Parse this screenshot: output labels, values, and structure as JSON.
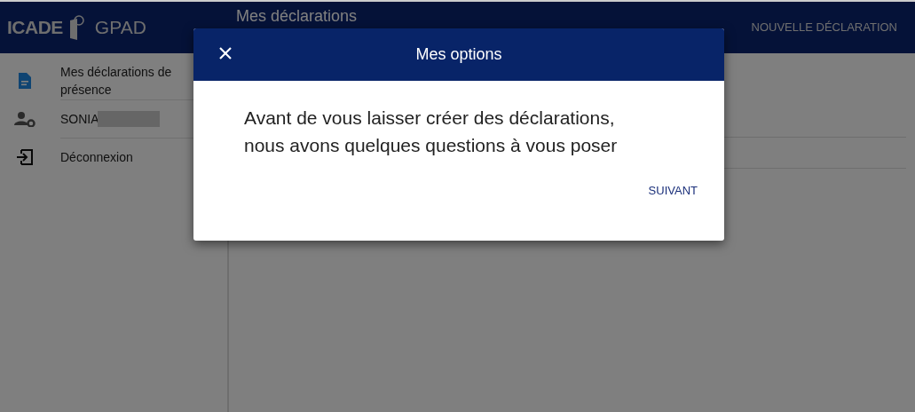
{
  "header": {
    "brand": "ICADE",
    "app_name": "GPAD",
    "title": "Mes déclarations",
    "action": "NOUVELLE DÉCLARATION"
  },
  "sidebar": {
    "items": [
      {
        "kind": "document",
        "label": "Mes déclarations de présence",
        "selected": true
      },
      {
        "kind": "user-settings",
        "label": "SONIA",
        "redacted": true,
        "selected": false
      },
      {
        "kind": "logout",
        "label": "Déconnexion",
        "selected": false
      }
    ]
  },
  "dialog": {
    "title": "Mes options",
    "message_lines": [
      "Avant de vous laisser créer des déclarations,",
      "nous avons quelques questions à vous poser"
    ],
    "button": "SUIVANT"
  }
}
